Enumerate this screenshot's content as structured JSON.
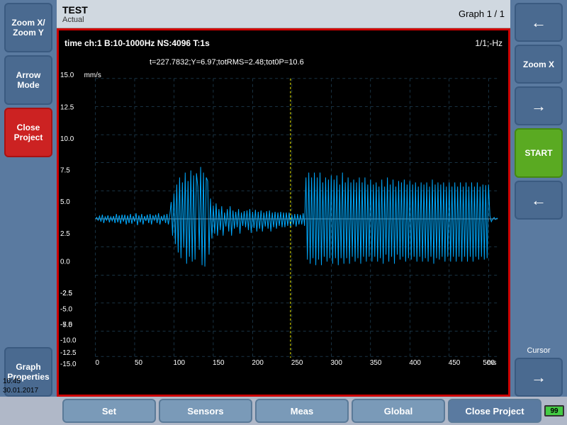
{
  "top_bar": {
    "test_name": "TEST",
    "actual_label": "Actual",
    "graph_info": "Graph 1 / 1"
  },
  "left_sidebar": {
    "zoom_xy_label": "Zoom X/ Zoom Y",
    "arrow_mode_label": "Arrow Mode",
    "close_project_label": "Close Project",
    "graph_properties_label": "Graph Properties"
  },
  "right_sidebar": {
    "zoom_x_label": "Zoom X",
    "start_label": "START",
    "cursor_label": "Cursor"
  },
  "chart": {
    "header_left": "time ch:1 B:10-1000Hz NS:4096 T:1s",
    "header_right": "1/1;-Hz",
    "stats": "t=227.7832;Y=6.97;totRMS=2.48;tot0P=10.6",
    "y_unit": "mm/s",
    "x_unit": "ms",
    "y_max": "15.0",
    "y_min": "-15.0",
    "x_min": "0",
    "x_max": "500"
  },
  "bottom_bar": {
    "set_label": "Set",
    "sensors_label": "Sensors",
    "meas_label": "Meas",
    "global_label": "Global",
    "close_project_label": "Close Project"
  },
  "datetime": {
    "time": "10:45",
    "date": "30.01.2017"
  },
  "battery": {
    "value": "99"
  }
}
